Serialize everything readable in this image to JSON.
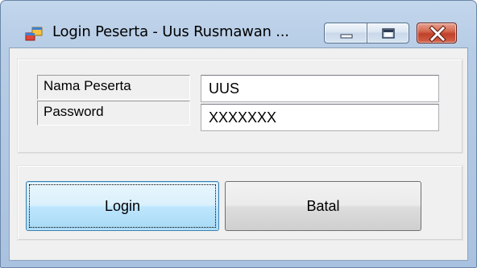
{
  "window": {
    "title": "Login Peserta - Uus Rusmawan ..."
  },
  "form": {
    "nama_label": "Nama Peserta",
    "nama_value": "UUS",
    "password_label": "Password",
    "password_value": "XXXXXXX"
  },
  "buttons": {
    "login_label": "Login",
    "batal_label": "Batal"
  },
  "icons": {
    "app": "form-window-icon",
    "minimize": "minimize-icon",
    "maximize": "maximize-icon",
    "close": "close-icon"
  },
  "colors": {
    "titlebar": "#b7cde6",
    "client_bg": "#f0f0f0",
    "close_button": "#c0412a",
    "focused_button": "#bee6fd"
  }
}
